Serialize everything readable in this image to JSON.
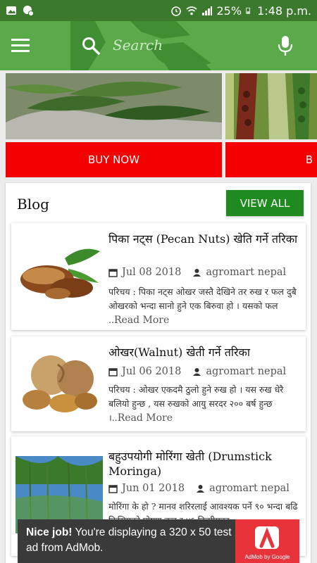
{
  "status_bar": {
    "battery": "25%",
    "time": "1:48 p.m."
  },
  "toolbar": {
    "search_placeholder": "Search"
  },
  "banners": [
    {
      "button_label": "BUY NOW"
    },
    {
      "button_label": "B"
    }
  ],
  "blog": {
    "heading": "Blog",
    "view_all_label": "VIEW ALL",
    "posts": [
      {
        "title": "पिका नट्स (Pecan Nuts) खेति गर्ने तरिका",
        "date": "Jul 08 2018",
        "author": "agromart nepal",
        "excerpt": "परिचय : पिका नट्स ओखर जस्तै देखिने तर रुख र फल दुबै ओखरको भन्दा सानो हुने एक बिरुवा हो । यसको फल ..",
        "read_more": "Read More"
      },
      {
        "title": "ओखर(Walnut) खेती गर्ने तरिका",
        "date": "Jul 06 2018",
        "author": "agromart nepal",
        "excerpt": "परिचय : ओखर एकदमै ठुलो हुने रुख हो । यस रुख धेरै बलियो हुन्छ , यस रुखको आयु सरदर २०० बर्ष हुन्छ ।..",
        "read_more": "Read More"
      },
      {
        "title": "बहुउपयोगी मोरिंगा खेती (Drumstick Moringa)",
        "date": "Jun 01 2018",
        "author": "agromart nepal",
        "excerpt": "मोरिंगा के हो ? मानव शरिरलाई आवश्यक पर्ने ९० भन्दा बढि किसिमको पोषण तत्व र ४६ किसीमका",
        "read_more": ""
      }
    ]
  },
  "ad": {
    "headline": "Nice job!",
    "body": "You're displaying a 320 x 50 test ad from AdMob.",
    "brand": "AdMob by Google"
  },
  "colors": {
    "status_bar": "#3b7a2d",
    "toolbar": "#5aaa4a",
    "buy_button": "#f50000",
    "view_all": "#1f8a1f",
    "ad_bg": "#3a3a3a",
    "ad_logo": "#e8333a"
  }
}
